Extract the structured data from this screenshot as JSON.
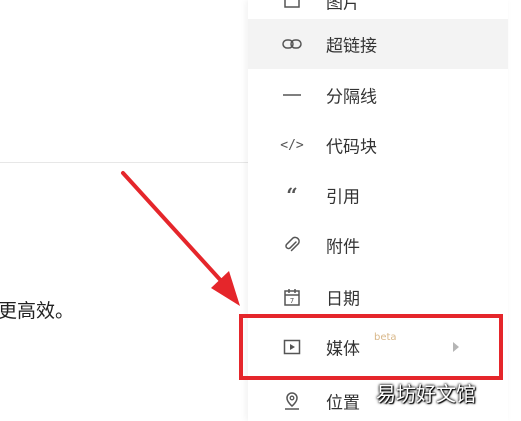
{
  "document": {
    "trailing_text": "更高效。"
  },
  "insert_menu": {
    "items": [
      {
        "icon": "image-icon",
        "label": "图片",
        "visible_partial": true
      },
      {
        "icon": "link-icon",
        "label": "超链接"
      },
      {
        "icon": "divider-icon",
        "label": "分隔线"
      },
      {
        "icon": "code-block-icon",
        "label": "代码块"
      },
      {
        "icon": "quote-icon",
        "label": "引用"
      },
      {
        "icon": "attachment-icon",
        "label": "附件"
      },
      {
        "icon": "calendar-icon",
        "label": "日期"
      },
      {
        "icon": "media-icon",
        "label": "媒体",
        "badge": "beta",
        "has_submenu": true,
        "highlighted": true
      },
      {
        "icon": "location-icon",
        "label": "位置"
      }
    ]
  },
  "annotation": {
    "highlight_color": "#e5262b",
    "arrow_color": "#e5262b"
  },
  "watermark": {
    "text": "易坊好文馆"
  }
}
